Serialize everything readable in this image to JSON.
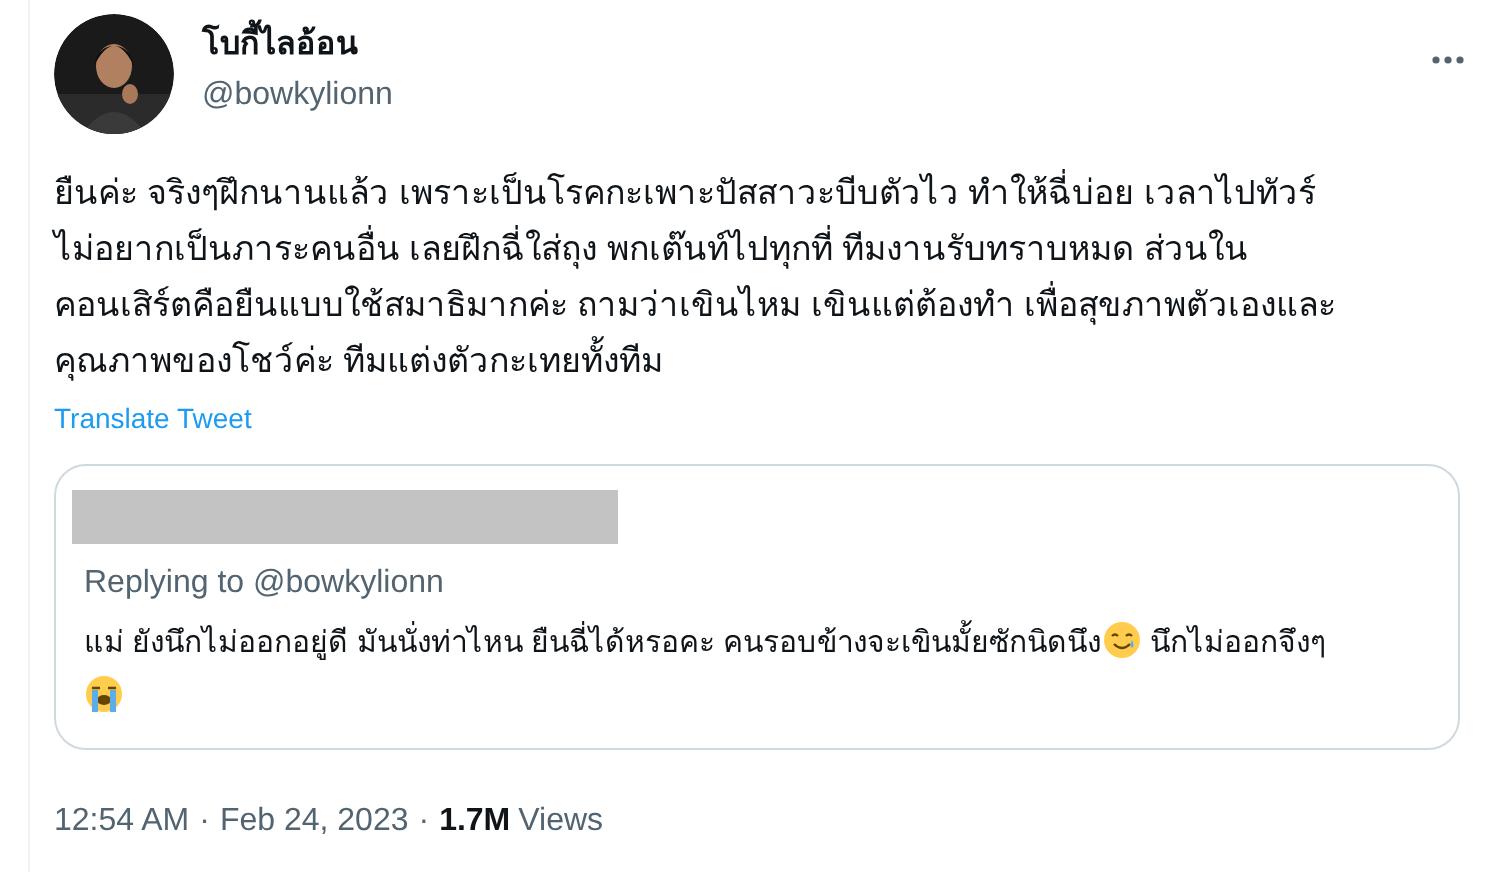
{
  "author": {
    "name": "โบกี้ไลอ้อน",
    "handle": "@bowkylionn"
  },
  "text": "ยืนค่ะ จริงๆฝึกนานแล้ว เพราะเป็นโรคกะเพาะปัสสาวะบีบตัวไว ทำให้ฉี่บ่อย เวลาไปทัวร์ไม่อยากเป็นภาระคนอื่น เลยฝึกฉี่ใส่ถุง พกเต๊นท์ไปทุกที่ ทีมงานรับทราบหมด ส่วนในคอนเสิร์ตคือยืนแบบใช้สมาธิมากค่ะ ถามว่าเขินไหม เขินแต่ต้องทำ เพื่อสุขภาพตัวเองและคุณภาพของโชว์ค่ะ ทีมแต่งตัวกะเทยทั้งทีม",
  "translate_link": "Translate Tweet",
  "quote": {
    "replying_to": "Replying to @bowkylionn",
    "body": [
      {
        "kind": "text",
        "text": "แม่ ยังนึกไม่ออกอยู่ดี มันนั่งท่าไหน ยืนฉี่ได้หรอคะ คนรอบข้างจะเขินมั้ยซักนิดนึง"
      },
      {
        "kind": "tear-smile"
      },
      {
        "kind": "text",
        "text": " นึกไม่ออกจึงๆ"
      },
      {
        "kind": "crying"
      }
    ]
  },
  "meta": {
    "separator": "·",
    "time": "12:54 AM",
    "date": "Feb 24, 2023",
    "views_count": "1.7M",
    "views_label": "Views"
  }
}
